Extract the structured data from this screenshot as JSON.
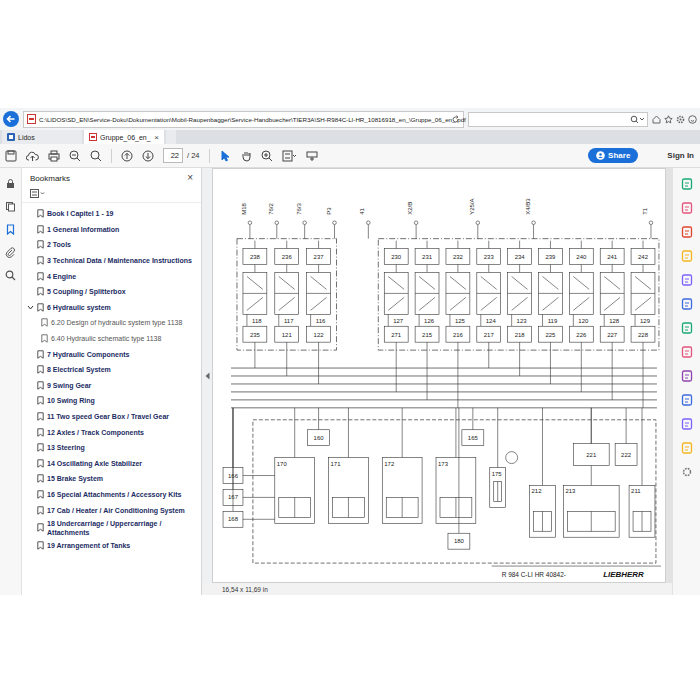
{
  "address_bar": {
    "url": "C:\\LIDOS\\SD_EN\\Service-Doku\\Dokumentation\\Mobil-Raupenbagger\\Service-Handbuecher\\TIER3A\\SH-R984C-LI-HR_10816918_en_\\Gruppe_06_en_.pdf"
  },
  "tabs": [
    {
      "label": "Lidos",
      "selected": false,
      "close": ""
    },
    {
      "label": "Gruppe_06_en_",
      "selected": true,
      "close": "×"
    }
  ],
  "toolbar": {
    "page": "22",
    "page_count": "/ 24",
    "tools": [
      {
        "kind": "select",
        "selected": true
      },
      {
        "kind": "hand",
        "selected": false
      }
    ],
    "share": "Share",
    "sign_in": "Sign In"
  },
  "left_rail": [
    {
      "kind": "lock",
      "selected": false
    },
    {
      "kind": "copy",
      "selected": false
    },
    {
      "kind": "bookmark",
      "selected": true
    },
    {
      "kind": "attach",
      "selected": false
    },
    {
      "kind": "search",
      "selected": false
    }
  ],
  "bookmarks": {
    "title": "Bookmarks",
    "close": "×",
    "items": [
      {
        "label": "Book I Capitel 1 - 19",
        "expanded": false
      },
      {
        "label": "1 General Information",
        "expanded": false
      },
      {
        "label": "2 Tools",
        "expanded": false
      },
      {
        "label": "3 Technical Data / Maintenance Instructions",
        "expanded": false
      },
      {
        "label": "4 Engine",
        "expanded": false
      },
      {
        "label": "5 Coupling / Splitterbox",
        "expanded": false
      },
      {
        "label": "6 Hydraulic system",
        "expanded": true,
        "children": [
          "6.20 Design of hydraulic system type 1138",
          "6.40 Hydraulic schematic type 1138"
        ]
      },
      {
        "label": "7 Hydraulic Components",
        "expanded": false
      },
      {
        "label": "8 Electrical System",
        "expanded": false
      },
      {
        "label": "9 Swing Gear",
        "expanded": false
      },
      {
        "label": "10 Swing Ring",
        "expanded": false
      },
      {
        "label": "11 Two speed Gear Box / Travel Gear",
        "expanded": false
      },
      {
        "label": "12 Axles / Track Components",
        "expanded": false
      },
      {
        "label": "13 Steering",
        "expanded": false
      },
      {
        "label": "14 Oscillating Axle Stabilizer",
        "expanded": false
      },
      {
        "label": "15 Brake System",
        "expanded": false
      },
      {
        "label": "16 Special Attachments / Accessory Kits",
        "expanded": false
      },
      {
        "label": "17 Cab / Heater / Air Conditioning System",
        "expanded": false
      },
      {
        "label": "18 Undercarriage / Uppercarriage / Attachments",
        "expanded": false
      },
      {
        "label": "19 Arrangement of Tanks",
        "expanded": false
      }
    ]
  },
  "schematic": {
    "ports": [
      "M18",
      "76/2",
      "76/3",
      "P3",
      "41",
      "X2/B",
      "Y25/A",
      "X4/B3",
      "T1"
    ],
    "sections": [
      {
        "top": "238",
        "mid": "118",
        "bottom": "235"
      },
      {
        "top": "236",
        "mid": "117",
        "bottom": "121"
      },
      {
        "top": "237",
        "mid": "116",
        "bottom": "122"
      },
      {
        "top": "230",
        "mid": "127",
        "bottom": "271"
      },
      {
        "top": "231",
        "mid": "126",
        "bottom": "215"
      },
      {
        "top": "232",
        "mid": "125",
        "bottom": "216"
      },
      {
        "top": "233",
        "mid": "124",
        "bottom": "217"
      },
      {
        "top": "234",
        "mid": "123",
        "bottom": "218"
      },
      {
        "top": "239",
        "mid": "119",
        "bottom": "225"
      },
      {
        "top": "240",
        "mid": "120",
        "bottom": "226"
      },
      {
        "top": "241",
        "mid": "128",
        "bottom": "227"
      },
      {
        "top": "242",
        "mid": "129",
        "bottom": "228"
      }
    ],
    "components": [
      "160",
      "165",
      "170",
      "171",
      "172",
      "173",
      "175",
      "166",
      "167",
      "168",
      "180",
      "211",
      "212",
      "213",
      "221",
      "222"
    ],
    "title": "R 984 C-LI HR 40842-",
    "logo": "LIEBHERR"
  },
  "status_bar": {
    "page_size": "16,54 x 11,69 in"
  }
}
